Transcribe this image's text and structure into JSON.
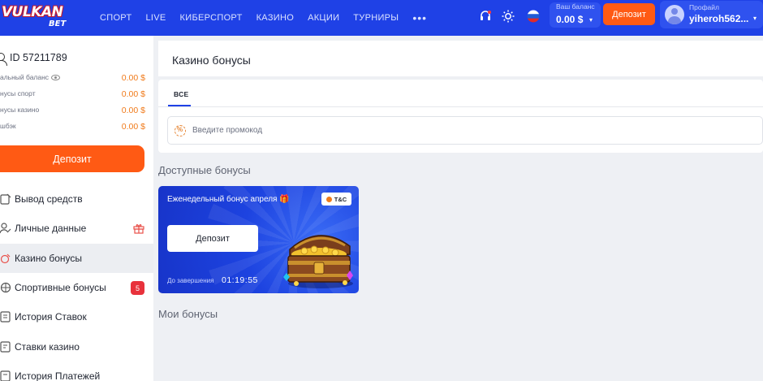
{
  "header": {
    "logo_top": "VULKAN",
    "logo_bottom": "BET",
    "nav": [
      "СПОРТ",
      "LIVE",
      "КИБЕРСПОРТ",
      "КАЗИНО",
      "АКЦИИ",
      "ТУРНИРЫ"
    ],
    "more": "•••",
    "balance_label": "Ваш баланс",
    "balance_value": "0.00 $",
    "deposit_label": "Депозит",
    "profile_label": "Профайл",
    "profile_name": "yiheroh562..."
  },
  "sidebar": {
    "user_id": "ID 57211789",
    "balances": [
      {
        "label": "альный баланс",
        "value": "0.00 $"
      },
      {
        "label": "нусы спорт",
        "value": "0.00 $"
      },
      {
        "label": "нусы казино",
        "value": "0.00 $"
      },
      {
        "label": "шбэк",
        "value": "0.00 $"
      }
    ],
    "deposit_label": "Депозит",
    "menu": [
      {
        "label": "Вывод средств",
        "icon": "withdraw-icon"
      },
      {
        "label": "Личные данные",
        "icon": "user-edit-icon"
      },
      {
        "label": "Казино бонусы",
        "icon": "casino-bonus-icon"
      },
      {
        "label": "Спортивные бонусы",
        "icon": "sport-bonus-icon",
        "badge": "5"
      },
      {
        "label": "История Ставок",
        "icon": "history-icon"
      },
      {
        "label": "Ставки казино",
        "icon": "casino-bets-icon"
      },
      {
        "label": "История Платежей",
        "icon": "payments-icon"
      }
    ]
  },
  "main": {
    "title": "Казино бонусы",
    "tab_all": "ВСЕ",
    "promo_placeholder": "Введите промокод",
    "available_title": "Доступные бонусы",
    "my_title": "Мои бонусы"
  },
  "bonus_card": {
    "name": "Еженедельный бонус апреля 🎁",
    "tc_label": "T&C",
    "deposit_label": "Депозит",
    "until_label": "До завершения",
    "timer": "01:19:55"
  },
  "colors": {
    "brand_blue": "#1f41e6",
    "accent_orange": "#ff5a14",
    "badge_red": "#e8323c"
  }
}
